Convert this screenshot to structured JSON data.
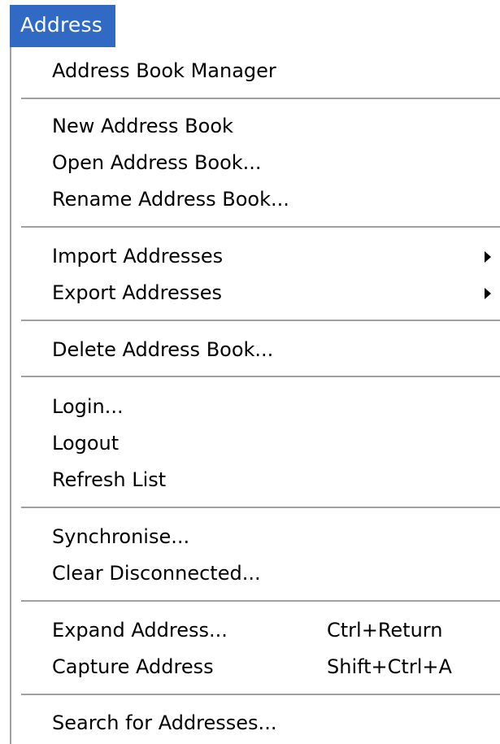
{
  "menu": {
    "title": "Address",
    "items": {
      "address_book_manager": "Address Book Manager",
      "new_address_book": "New Address Book",
      "open_address_book": "Open Address Book...",
      "rename_address_book": "Rename Address Book...",
      "import_addresses": "Import Addresses",
      "export_addresses": "Export Addresses",
      "delete_address_book": "Delete Address Book...",
      "login": "Login...",
      "logout": "Logout",
      "refresh_list": "Refresh List",
      "synchronise": "Synchronise...",
      "clear_disconnected": "Clear Disconnected...",
      "expand_address": "Expand Address...",
      "capture_address": "Capture Address",
      "search_for_addresses": "Search for Addresses..."
    },
    "shortcuts": {
      "expand_address": "Ctrl+Return",
      "capture_address": "Shift+Ctrl+A"
    },
    "submenus": {
      "import_addresses": "submenu-arrow-icon",
      "export_addresses": "submenu-arrow-icon"
    }
  },
  "colors": {
    "menu_title_background": "#316ac5",
    "menu_title_text": "#ffffff",
    "menu_background": "#ffffff",
    "separator": "#a0a0a0",
    "text": "#000000"
  }
}
